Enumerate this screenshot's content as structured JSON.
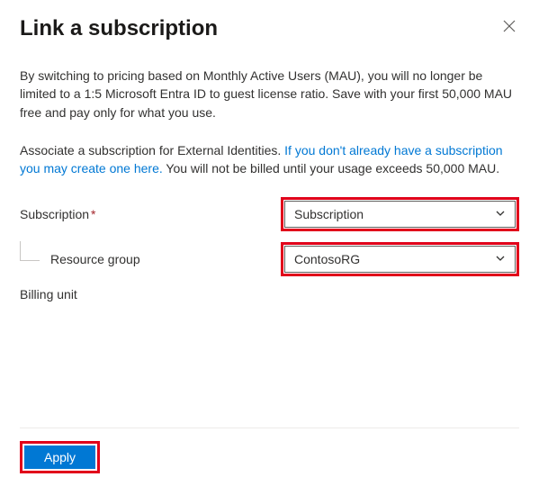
{
  "header": {
    "title": "Link a subscription"
  },
  "intro": "By switching to pricing based on Monthly Active Users (MAU), you will no longer be limited to a 1:5 Microsoft Entra ID to guest license ratio. Save with your first 50,000 MAU free and pay only for what you use.",
  "associate": {
    "lead": "Associate a subscription for External Identities. ",
    "link": "If you don't already have a subscription you may create one here.",
    "tail": " You will not be billed until your usage exceeds 50,000 MAU."
  },
  "form": {
    "subscription": {
      "label": "Subscription",
      "required_marker": "*",
      "value": "Subscription"
    },
    "resource_group": {
      "label": "Resource group",
      "value": "ContosoRG"
    },
    "billing_unit": {
      "label": "Billing unit"
    }
  },
  "footer": {
    "apply_label": "Apply"
  }
}
